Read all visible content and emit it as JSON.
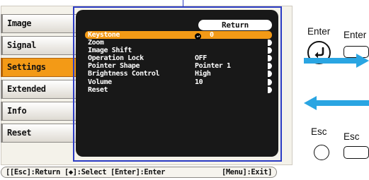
{
  "sidebar": {
    "items": [
      {
        "label": "Image",
        "active": false
      },
      {
        "label": "Signal",
        "active": false
      },
      {
        "label": "Settings",
        "active": true
      },
      {
        "label": "Extended",
        "active": false
      },
      {
        "label": "Info",
        "active": false
      },
      {
        "label": "Reset",
        "active": false
      }
    ]
  },
  "menu": {
    "return_label": "Return",
    "items": [
      {
        "label": "Keystone",
        "value": "0",
        "selected": true
      },
      {
        "label": "Zoom",
        "value": ""
      },
      {
        "label": "Image Shift",
        "value": ""
      },
      {
        "label": "Operation Lock",
        "value": "OFF"
      },
      {
        "label": "Pointer Shape",
        "value": "Pointer 1"
      },
      {
        "label": "Brightness Control",
        "value": "High"
      },
      {
        "label": "Volume",
        "value": "10"
      },
      {
        "label": "Reset",
        "value": ""
      }
    ]
  },
  "hint_bar": {
    "left": "[[Esc]:Return [◆]:Select [Enter]:Enter",
    "right": "[Menu]:Exit]"
  },
  "legend": {
    "enter_label_1": "Enter",
    "enter_label_2": "Enter",
    "esc_label_1": "Esc",
    "esc_label_2": "Esc"
  },
  "colors": {
    "accent": "#f39a16",
    "panel_dark": "#181818",
    "focus_outline": "#2b3bc4",
    "arrow": "#2aa5e2"
  }
}
